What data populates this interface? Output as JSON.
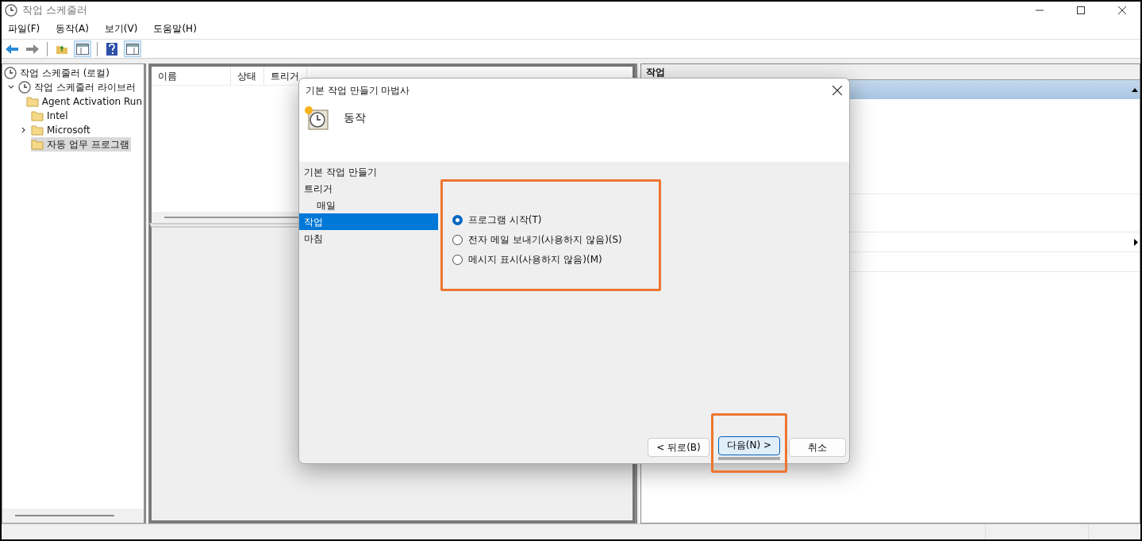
{
  "window": {
    "title": "작업 스케줄러"
  },
  "menu": [
    {
      "label": "파일(F)"
    },
    {
      "label": "동작(A)"
    },
    {
      "label": "보기(V)"
    },
    {
      "label": "도움말(H)"
    }
  ],
  "tree": {
    "label": "작업 스케줄러 (로컬)",
    "children": [
      {
        "label": "작업 스케줄러 라이브러",
        "expanded": true,
        "selected": false,
        "children": [
          {
            "label": "Agent Activation Run",
            "selected": false
          },
          {
            "label": "Intel",
            "selected": false
          },
          {
            "label": "Microsoft",
            "expanded": false,
            "selected": false
          },
          {
            "label": "자동 업무 프로그램",
            "selected": true
          }
        ]
      }
    ]
  },
  "task_list": {
    "columns": [
      "이름",
      "상태",
      "트리거"
    ]
  },
  "actions_pane": {
    "title": "작업"
  },
  "dialog": {
    "title": "기본 작업 만들기 마법사",
    "heading": "동작",
    "steps": [
      {
        "label": "기본 작업 만들기",
        "selected": false
      },
      {
        "label": "트리거",
        "selected": false,
        "children": [
          {
            "label": "매일",
            "selected": false
          }
        ]
      },
      {
        "label": "작업",
        "selected": true
      },
      {
        "label": "마침",
        "selected": false
      }
    ],
    "options": [
      {
        "label": "프로그램 시작(T)",
        "selected": true
      },
      {
        "label": "전자 메일 보내기(사용하지 않음)(S)",
        "selected": false
      },
      {
        "label": "메시지 표시(사용하지 않음)(M)",
        "selected": false
      }
    ],
    "options_highlighted": true,
    "buttons": [
      {
        "label": "< 뒤로(B)",
        "default": false,
        "highlighted": false
      },
      {
        "label": "다음(N) >",
        "default": true,
        "highlighted": true
      },
      {
        "label": "취소",
        "default": false,
        "highlighted": false
      }
    ]
  }
}
